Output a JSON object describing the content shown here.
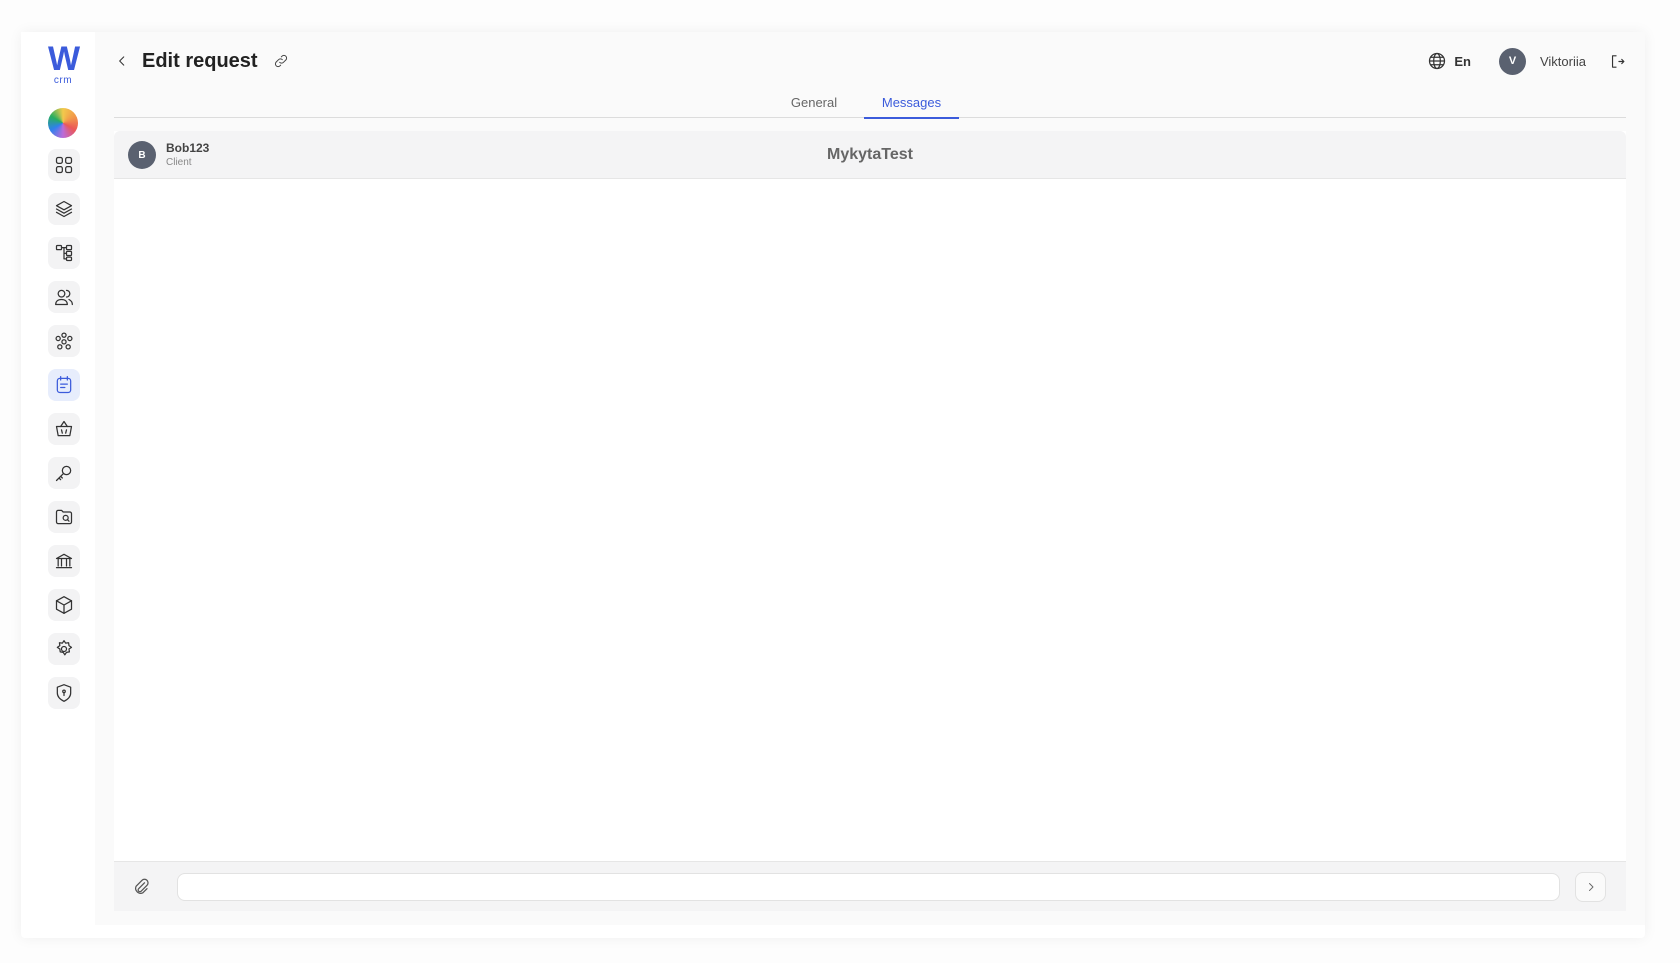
{
  "app": {
    "logo_letter": "W",
    "logo_sub": "crm",
    "accent_color": "#3b5bdb"
  },
  "sidebar": {
    "items": [
      {
        "icon": "dashboard-grid-icon",
        "active": false
      },
      {
        "icon": "layers-icon",
        "active": false
      },
      {
        "icon": "hierarchy-icon",
        "active": false
      },
      {
        "icon": "users-icon",
        "active": false
      },
      {
        "icon": "network-icon",
        "active": false
      },
      {
        "icon": "requests-icon",
        "active": true
      },
      {
        "icon": "basket-icon",
        "active": false
      },
      {
        "icon": "key-icon",
        "active": false
      },
      {
        "icon": "folder-search-icon",
        "active": false
      },
      {
        "icon": "bank-icon",
        "active": false
      },
      {
        "icon": "box-icon",
        "active": false
      },
      {
        "icon": "settings-icon",
        "active": false
      },
      {
        "icon": "shield-icon",
        "active": false
      }
    ]
  },
  "header": {
    "title": "Edit request",
    "language": "En",
    "user_initial": "V",
    "user_name": "Viktoriia"
  },
  "tabs": [
    {
      "label": "General",
      "active": false
    },
    {
      "label": "Messages",
      "active": true
    }
  ],
  "chat": {
    "client_initial": "B",
    "client_name": "Bob123",
    "client_role": "Client",
    "title": "MykytaTest",
    "input_value": ""
  }
}
